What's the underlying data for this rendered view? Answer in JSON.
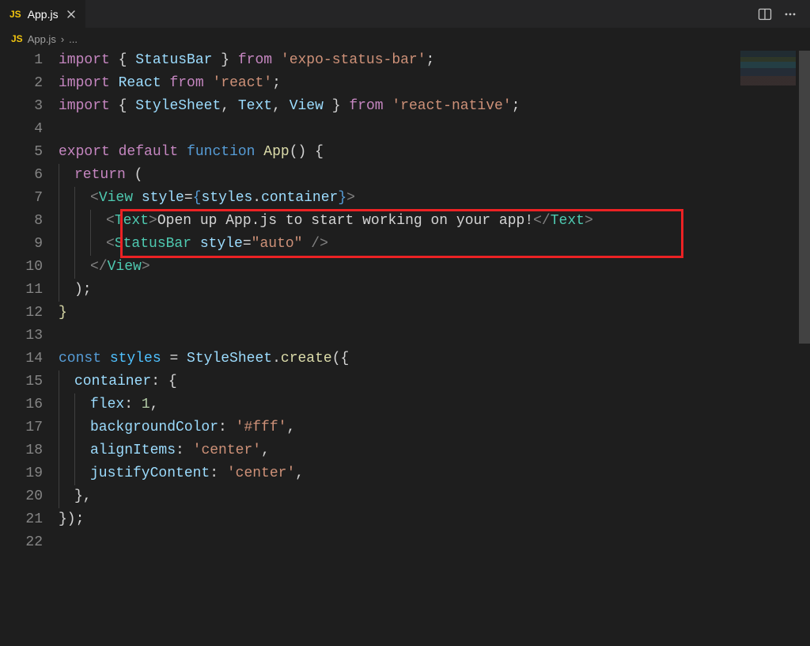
{
  "tab": {
    "icon": "JS",
    "label": "App.js"
  },
  "breadcrumb": {
    "icon": "JS",
    "file": "App.js",
    "sep": "›",
    "more": "..."
  },
  "gutter": [
    "1",
    "2",
    "3",
    "4",
    "5",
    "6",
    "7",
    "8",
    "9",
    "10",
    "11",
    "12",
    "13",
    "14",
    "15",
    "16",
    "17",
    "18",
    "19",
    "20",
    "21",
    "22"
  ],
  "code": {
    "l1": {
      "import": "import",
      "brO": "{ ",
      "StatusBar": "StatusBar",
      "brC": " }",
      "from": "from",
      "s": "'expo-status-bar'",
      "semi": ";"
    },
    "l2": {
      "import": "import",
      "React": "React",
      "from": "from",
      "s": "'react'",
      "semi": ";"
    },
    "l3": {
      "import": "import",
      "brO": "{ ",
      "StyleSheet": "StyleSheet",
      "c1": ", ",
      "Text": "Text",
      "c2": ", ",
      "View": "View",
      "brC": " }",
      "from": "from",
      "s": "'react-native'",
      "semi": ";"
    },
    "l5": {
      "export": "export",
      "default": "default",
      "function": "function",
      "App": "App",
      "paren": "()",
      "brace": " {"
    },
    "l6": {
      "return": "return",
      "paren": " ("
    },
    "l7": {
      "lt": "<",
      "View": "View",
      "sp": " ",
      "style": "style",
      "eq": "=",
      "bo": "{",
      "styles": "styles",
      "dot": ".",
      "container": "container",
      "bc": "}",
      "gt": ">"
    },
    "l8": {
      "lt": "<",
      "Text": "Text",
      "gt1": ">",
      "inner": "Open up App.js to start working on your app!",
      "lt2": "</",
      "Text2": "Text",
      "gt2": ">"
    },
    "l9": {
      "lt": "<",
      "StatusBar": "StatusBar",
      "sp": " ",
      "style": "style",
      "eq": "=",
      "val": "\"auto\"",
      "close": " />"
    },
    "l10": {
      "lt": "</",
      "View": "View",
      "gt": ">"
    },
    "l11": {
      "close": ");"
    },
    "l12": {
      "brace": "}"
    },
    "l14": {
      "const": "const",
      "styles": "styles",
      "eq": " = ",
      "StyleSheet": "StyleSheet",
      "dot": ".",
      "create": "create",
      "paren": "({"
    },
    "l15": {
      "container": "container",
      "colon": ": {"
    },
    "l16": {
      "flex": "flex",
      "colon": ": ",
      "one": "1",
      "comma": ","
    },
    "l17": {
      "backgroundColor": "backgroundColor",
      "colon": ": ",
      "val": "'#fff'",
      "comma": ","
    },
    "l18": {
      "alignItems": "alignItems",
      "colon": ": ",
      "val": "'center'",
      "comma": ","
    },
    "l19": {
      "justifyContent": "justifyContent",
      "colon": ": ",
      "val": "'center'",
      "comma": ","
    },
    "l20": {
      "close": "},"
    },
    "l21": {
      "close": "});"
    }
  }
}
